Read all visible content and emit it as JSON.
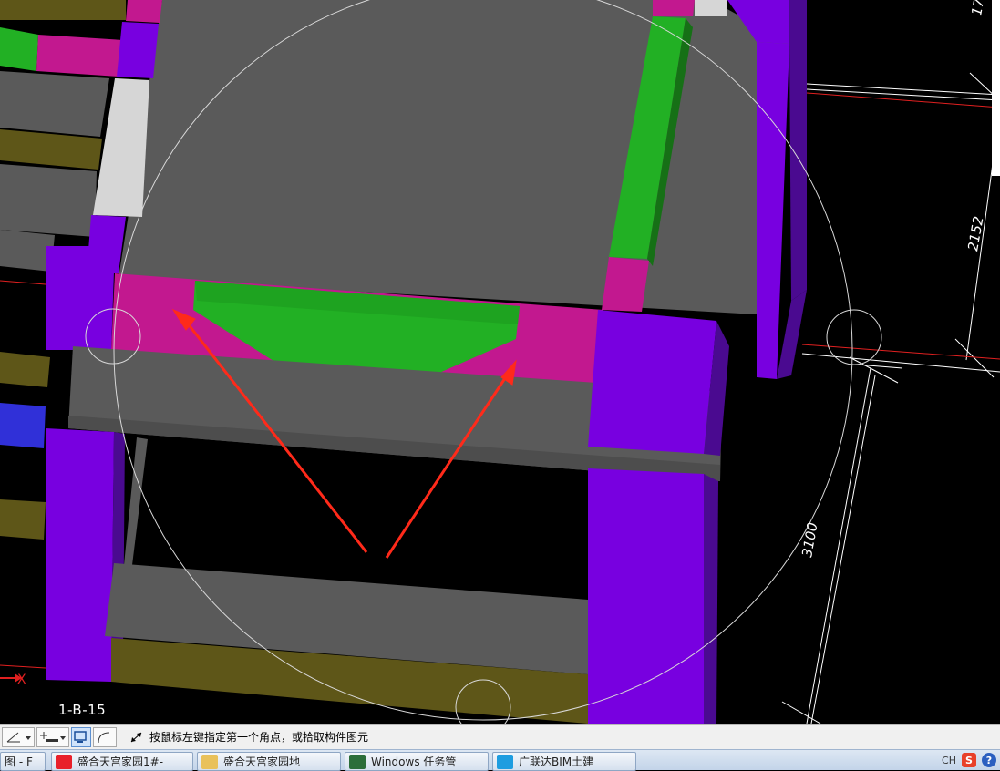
{
  "viewport": {
    "dimensions": [
      "3100",
      "2152",
      "17"
    ],
    "axis_label": "X",
    "floor_label": "1-B-15"
  },
  "statusbar": {
    "tools": [
      "angle-tool",
      "add-point-tool",
      "select-view-tool",
      "arc-tool"
    ],
    "prompt": "按鼠标左键指定第一个角点，或拾取构件图元"
  },
  "taskbar": {
    "items": [
      {
        "label": "图 - F"
      },
      {
        "label": "盛合天宫家园1#-"
      },
      {
        "label": "盛合天宫家园地"
      },
      {
        "label": "Windows 任务管"
      },
      {
        "label": "广联达BIM土建"
      }
    ],
    "tray": {
      "ime": "CH",
      "sogou": "S",
      "help": "?"
    }
  },
  "colors": {
    "slab": "#5a5a5a",
    "column": "#7800e0",
    "beam_magenta": "#c2188f",
    "beam_green": "#22b024",
    "olive": "#5e5618",
    "arrow": "#ff2a1a"
  }
}
